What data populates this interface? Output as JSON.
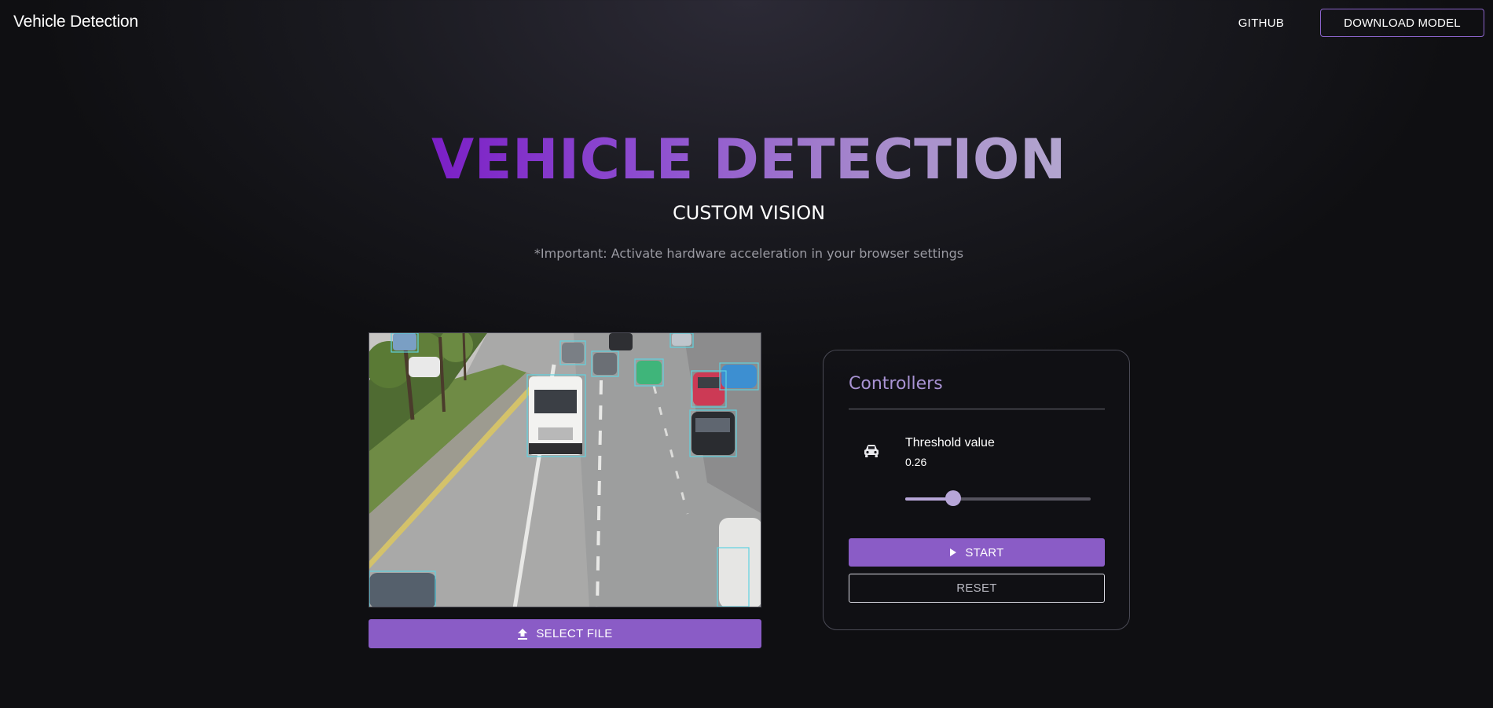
{
  "navbar": {
    "brand": "Vehicle Detection",
    "github_label": "GITHUB",
    "download_label": "DOWNLOAD MODEL"
  },
  "hero": {
    "title": "VEHICLE DETECTION",
    "subtitle": "CUSTOM VISION",
    "note": "*Important: Activate hardware acceleration in your browser settings"
  },
  "preview": {
    "select_file_label": "SELECT FILE",
    "icons": {
      "upload": "upload-icon"
    }
  },
  "controllers": {
    "title": "Controllers",
    "threshold_label": "Threshold value",
    "threshold_value": "0.26",
    "slider_fraction": 0.26,
    "start_label": "START",
    "reset_label": "RESET",
    "icons": {
      "car": "car-icon",
      "play": "play-icon"
    }
  },
  "colors": {
    "accent": "#8a5cc6",
    "panel_title": "#a993d4",
    "slider": "#b7a6d8",
    "detection_box": "#5fd3e0"
  }
}
